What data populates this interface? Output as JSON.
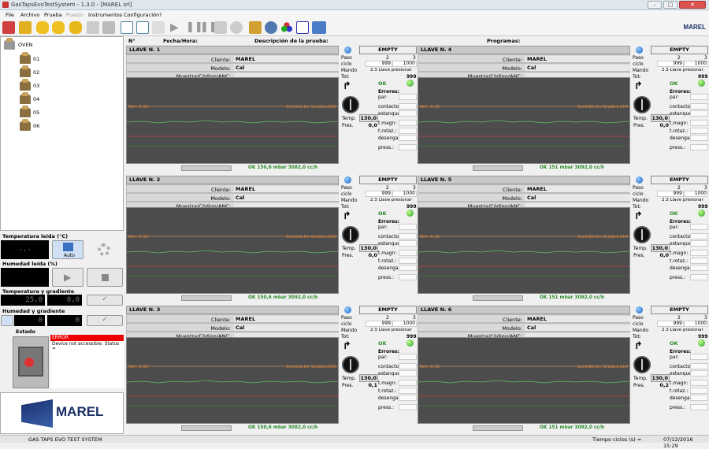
{
  "window": {
    "title": "GasTapsEvoTestSystem - 1.3.0 - [MAREL srl]"
  },
  "menu": [
    "File",
    "Archivo",
    "Prueba",
    "Puesto",
    "Instrumentos",
    "Configuración",
    "?"
  ],
  "toolbar_icons": [
    "enter-icon",
    "lock-icon",
    "cylinder-icon",
    "cylinder-add-icon",
    "cylinder-list-icon",
    "copy-icon",
    "delete-icon",
    "document-icon",
    "document-list-icon",
    "edit-icon",
    "play-icon",
    "pause-icon",
    "pause-icon",
    "save-icon",
    "search-icon",
    "wrench-icon",
    "gear-icon",
    "palette-icon",
    "chart-icon",
    "book-icon"
  ],
  "brand": "MAREL",
  "tree": {
    "root": "OVEN",
    "items": [
      "01",
      "02",
      "03",
      "04",
      "05",
      "06"
    ]
  },
  "left": {
    "temp_label": "Temperatura leída (°C)",
    "temp_value": "-.-",
    "auto_label": "Auto",
    "hum_label": "Humedad leída (%)",
    "tg_label": "Temperatura y gradiente",
    "tg_value1": "25,0",
    "tg_value2": "0,0",
    "hg_label": "Humedad y gradiente",
    "hg_value1": "0",
    "hg_value2": "0",
    "estado_label": "Estado",
    "error_title": "ERROR",
    "error_text": "Device not accessible. Status ="
  },
  "header": {
    "n": "N°",
    "fecha": "Fecha/Hora:",
    "desc": "Descripción de la prueba:",
    "prog": "Programas:"
  },
  "labels": {
    "cliente": "Cliente:",
    "modelo": "Modelo:",
    "muestra": "Muestra/Código/ANC:",
    "empty": "EMPTY",
    "paso": "Paso",
    "ciclo": "ciclo",
    "mando": "Mando",
    "tot": "Tot:",
    "ok": "OK",
    "errores": "Errores:",
    "temp": "Temp.",
    "pres": "Pres.",
    "err_items": [
      "par:",
      "contactos:",
      "estanquei",
      "t.magn:",
      "t.rotaz.:",
      "desenganc",
      "press.:"
    ],
    "chart_left": "Nm: 0,35",
    "chart_right": "Sentido:Dx Grados:210"
  },
  "panels": [
    {
      "title": "LLAVE N. 1",
      "cliente": "MAREL",
      "modelo": "Cal",
      "paso": [
        "2",
        "3"
      ],
      "ciclo": [
        "999",
        "1000"
      ],
      "mando": "2.3 Llave presionar",
      "tot": "999",
      "temp": "130,0",
      "pres": "0,0",
      "status": "OK 150,6 mbar 3082,0 cc/h"
    },
    {
      "title": "LLAVE N. 4",
      "cliente": "MAREL",
      "modelo": "Cal",
      "paso": [
        "2",
        "3"
      ],
      "ciclo": [
        "999",
        "1000"
      ],
      "mando": "2.3 Llave presionar",
      "tot": "999",
      "temp": "130,0",
      "pres": "0,0",
      "status": "OK 151 mbar 3092,0 cc/h"
    },
    {
      "title": "LLAVE N. 2",
      "cliente": "MAREL",
      "modelo": "Cal",
      "paso": [
        "2",
        "3"
      ],
      "ciclo": [
        "999",
        "1000"
      ],
      "mando": "2.3 Llave presionar",
      "tot": "999",
      "temp": "130,0",
      "pres": "0,0",
      "status": "OK 150,6 mbar 3092,0 cc/h"
    },
    {
      "title": "LLAVE N. 5",
      "cliente": "MAREL",
      "modelo": "Cal",
      "paso": [
        "2",
        "3"
      ],
      "ciclo": [
        "999",
        "1000"
      ],
      "mando": "2.3 Llave presionar",
      "tot": "999",
      "temp": "130,0",
      "pres": "0,0",
      "status": "OK 151 mbar 3092,0 cc/h"
    },
    {
      "title": "LLAVE N. 3",
      "cliente": "MAREL",
      "modelo": "Cal",
      "paso": [
        "2",
        "3"
      ],
      "ciclo": [
        "999",
        "1000"
      ],
      "mando": "2.3 Llave presionar",
      "tot": "999",
      "temp": "130,0",
      "pres": "0,1",
      "status": "OK 150,6 mbar 3082,0 cc/h"
    },
    {
      "title": "LLAVE N. 6",
      "cliente": "MAREL",
      "modelo": "Cal",
      "paso": [
        "2",
        "3"
      ],
      "ciclo": [
        "999",
        "1000"
      ],
      "mando": "2.3 Llave presionar",
      "tot": "999",
      "temp": "130,0",
      "pres": "0,2",
      "status": "OK 151 mbar 3092,0 cc/h"
    }
  ],
  "statusbar": {
    "app": "GAS TAPS EVO TEST SYSTEM",
    "cycles": "Tiempo ciclos (s) =",
    "datetime": "07/12/2016 15:29"
  }
}
